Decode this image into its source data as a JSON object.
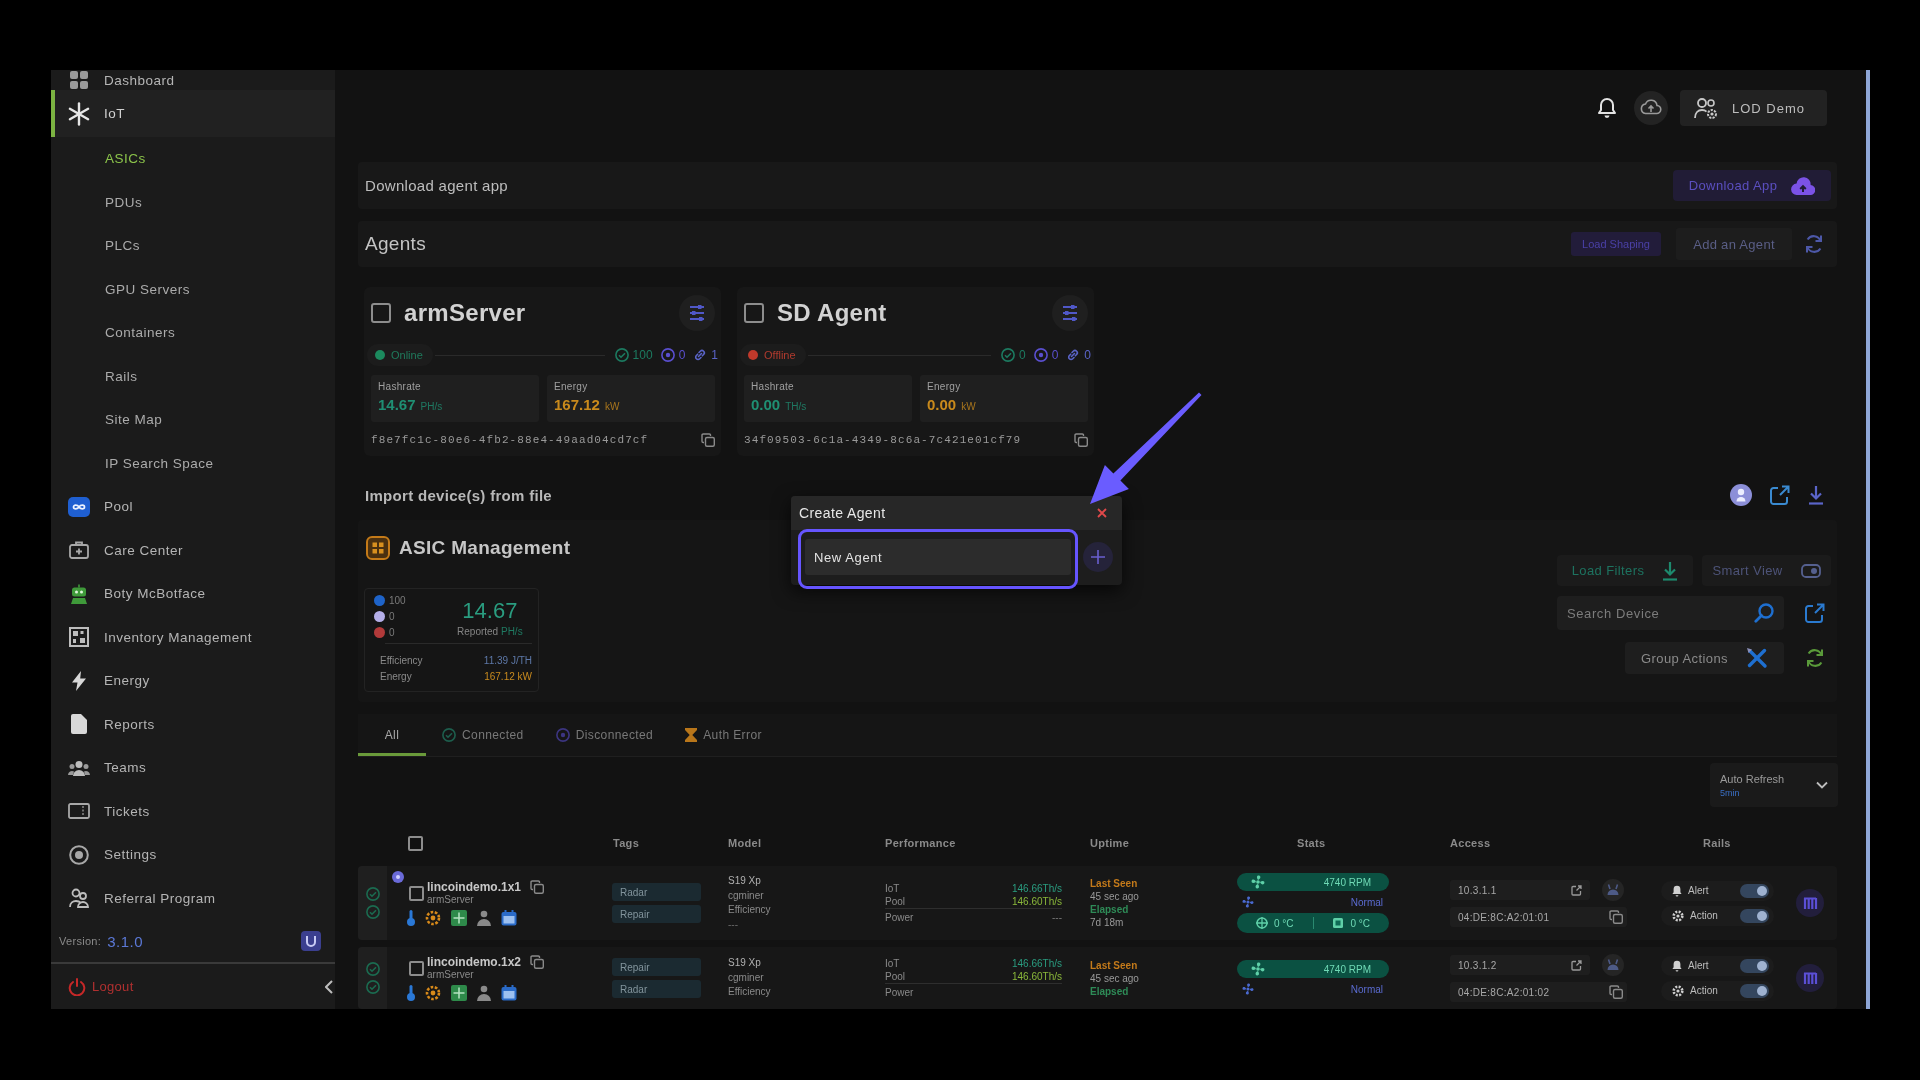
{
  "sidebar": {
    "items": [
      {
        "label": "Dashboard",
        "selected": false
      },
      {
        "label": "IoT",
        "selected": true,
        "children": [
          {
            "label": "ASICs",
            "selected": true
          },
          {
            "label": "PDUs",
            "selected": false
          },
          {
            "label": "PLCs",
            "selected": false
          },
          {
            "label": "GPU Servers",
            "selected": false
          },
          {
            "label": "Containers",
            "selected": false
          },
          {
            "label": "Rails",
            "selected": false
          },
          {
            "label": "Site Map",
            "selected": false
          },
          {
            "label": "IP Search Space",
            "selected": false
          }
        ]
      },
      {
        "label": "Pool",
        "selected": false
      },
      {
        "label": "Care Center",
        "selected": false
      },
      {
        "label": "Boty McBotface",
        "selected": false
      },
      {
        "label": "Inventory Management",
        "selected": false
      },
      {
        "label": "Energy",
        "selected": false
      },
      {
        "label": "Reports",
        "selected": false
      },
      {
        "label": "Teams",
        "selected": false
      },
      {
        "label": "Tickets",
        "selected": false
      },
      {
        "label": "Settings",
        "selected": false
      },
      {
        "label": "Referral Program",
        "selected": false
      }
    ],
    "version_label": "Version:",
    "version": "3.1.0",
    "logout": "Logout"
  },
  "header": {
    "user": "LOD Demo"
  },
  "download_panel": {
    "title": "Download agent app",
    "button": "Download App"
  },
  "agents": {
    "title": "Agents",
    "buttons": [
      "Load Shaping",
      "Add an Agent"
    ],
    "cards": [
      {
        "name": "armServer",
        "checked": false,
        "online": true,
        "status": "Online",
        "counts": [
          "100",
          "0",
          "1"
        ],
        "metrics": [
          {
            "label": "Hashrate",
            "value": "14.67",
            "unit": "PH/s"
          },
          {
            "label": "Energy",
            "value": "167.12",
            "unit": "kW"
          }
        ],
        "id": "f8e7fc1c-80e6-4fb2-88e4-49aad04cd7cf"
      },
      {
        "name": "SD Agent",
        "checked": false,
        "online": false,
        "status": "Offline",
        "counts": [
          "0",
          "0",
          "0"
        ],
        "metrics": [
          {
            "label": "Hashrate",
            "value": "0.00",
            "unit": "TH/s"
          },
          {
            "label": "Energy",
            "value": "0.00",
            "unit": "kW"
          }
        ],
        "id": "34f09503-6c1a-4349-8c6a-7c421e01cf79"
      }
    ]
  },
  "import_panel": {
    "title": "Import device(s) from file"
  },
  "asic_management": {
    "title": "ASIC Management",
    "legend": [
      {
        "value": "100",
        "color": "#1e63c8"
      },
      {
        "value": "0",
        "color": "#b4aee8"
      },
      {
        "value": "0",
        "color": "#b23a3a"
      }
    ],
    "total": "14.67",
    "total_label": "Reported",
    "total_unit": "PH/s",
    "details": [
      {
        "label": "Efficiency",
        "value": "11.39 J/TH"
      },
      {
        "label": "Energy",
        "value": "167.12 kW"
      }
    ],
    "buttons": [
      "Load Filters",
      "Smart View"
    ],
    "search": {
      "placeholder": "Search Device"
    },
    "group_actions": "Group Actions"
  },
  "tabs": [
    {
      "label": "All",
      "selected": true
    },
    {
      "label": "Connected",
      "selected": false
    },
    {
      "label": "Disconnected",
      "selected": false
    },
    {
      "label": "Auth Error",
      "selected": false
    }
  ],
  "auto_refresh": {
    "label": "Auto Refresh",
    "value": "5min"
  },
  "table": {
    "all_checked": false,
    "columns": [
      "Tags",
      "Model",
      "Performance",
      "Uptime",
      "Stats",
      "Access",
      "Rails"
    ],
    "rows": [
      {
        "checked": false,
        "dot_badge": true,
        "name": "lincoindemo.1x1",
        "agent": "armServer",
        "tags": [
          "Radar",
          "Repair"
        ],
        "model": [
          "S19 Xp",
          "cgminer",
          "Efficiency",
          "---"
        ],
        "performance": [
          {
            "label": "IoT",
            "value": "146.66Th/s"
          },
          {
            "label": "Pool",
            "value": "146.60Th/s"
          },
          {
            "label": "Power",
            "value": "---"
          }
        ],
        "uptime": [
          {
            "kind": "last_seen",
            "text": "Last Seen"
          },
          {
            "kind": "text",
            "text": "45 sec ago"
          },
          {
            "kind": "elapsed",
            "text": "Elapsed"
          },
          {
            "kind": "text",
            "text": "7d 18m"
          }
        ],
        "stats": {
          "fan": "4740 RPM",
          "state": "Normal",
          "temps": [
            "0 °C",
            "0 °C"
          ]
        },
        "access": {
          "ip": "10.3.1.1",
          "mac": "04:DE:8C:A2:01:01"
        },
        "rails": [
          {
            "label": "Alert",
            "on": true
          },
          {
            "label": "Action",
            "on": true
          }
        ]
      },
      {
        "checked": false,
        "dot_badge": false,
        "name": "lincoindemo.1x2",
        "agent": "armServer",
        "tags": [
          "Repair",
          "Radar"
        ],
        "model": [
          "S19 Xp",
          "cgminer",
          "Efficiency"
        ],
        "performance": [
          {
            "label": "IoT",
            "value": "146.66Th/s"
          },
          {
            "label": "Pool",
            "value": "146.60Th/s"
          },
          {
            "label": "Power"
          }
        ],
        "uptime": [
          {
            "kind": "last_seen",
            "text": "Last Seen"
          },
          {
            "kind": "text",
            "text": "45 sec ago"
          },
          {
            "kind": "elapsed",
            "text": "Elapsed"
          }
        ],
        "stats": {
          "fan": "4740 RPM",
          "state": "Normal"
        },
        "access": {
          "ip": "10.3.1.2",
          "mac": "04:DE:8C:A2:01:02"
        },
        "rails": [
          {
            "label": "Alert",
            "on": true
          },
          {
            "label": "Action",
            "on": true
          }
        ]
      }
    ]
  },
  "dialog": {
    "title": "Create Agent",
    "value": "New Agent"
  }
}
